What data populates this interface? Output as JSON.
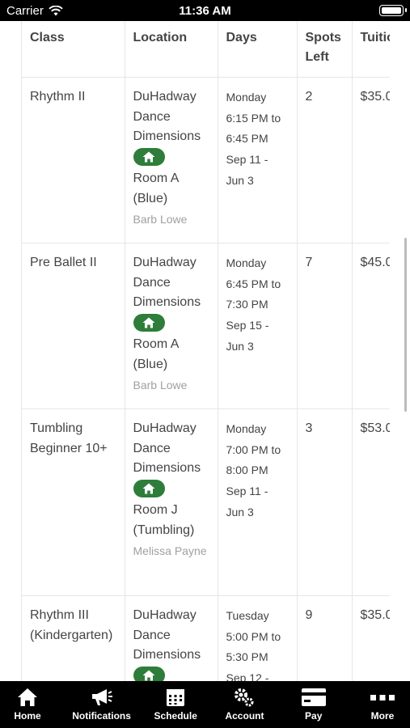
{
  "status_bar": {
    "carrier": "Carrier",
    "time": "11:36 AM"
  },
  "table": {
    "headers": {
      "class": "Class",
      "location": "Location",
      "days": "Days",
      "spots": "Spots Left",
      "tuition": "Tuitio"
    },
    "rows": [
      {
        "class": "Rhythm II",
        "location": "DuHadway Dance Dimensions",
        "room": "Room A (Blue)",
        "instructor": "Barb Lowe",
        "days": "Monday",
        "time": "6:15 PM to 6:45 PM",
        "dates": "Sep 11 - Jun 3",
        "spots": "2",
        "tuition": "$35.0"
      },
      {
        "class": "Pre Ballet II",
        "location": "DuHadway Dance Dimensions",
        "room": "Room A (Blue)",
        "instructor": "Barb Lowe",
        "days": "Monday",
        "time": "6:45 PM to 7:30 PM",
        "dates": "Sep 15 - Jun 3",
        "spots": "7",
        "tuition": "$45.0"
      },
      {
        "class": "Tumbling Beginner 10+",
        "location": "DuHadway Dance Dimensions",
        "room": "Room J (Tumbling)",
        "instructor": "Melissa Payne",
        "days": "Monday",
        "time": "7:00 PM to 8:00 PM",
        "dates": "Sep 11 - Jun 3",
        "spots": "3",
        "tuition": "$53.0"
      },
      {
        "class": "Rhythm III (Kindergarten)",
        "location": "DuHadway Dance Dimensions",
        "room": "",
        "instructor": "",
        "days": "Tuesday",
        "time": "5:00 PM to 5:30 PM",
        "dates": "Sep 12 -",
        "spots": "9",
        "tuition": "$35.0"
      }
    ]
  },
  "tab_bar": {
    "items": [
      {
        "label": "Home",
        "icon": "house-icon"
      },
      {
        "label": "Notifications",
        "icon": "megaphone-icon"
      },
      {
        "label": "Schedule",
        "icon": "calendar-icon"
      },
      {
        "label": "Account",
        "icon": "gears-icon"
      },
      {
        "label": "Pay",
        "icon": "credit-card-icon"
      },
      {
        "label": "More",
        "icon": "ellipsis-icon"
      }
    ]
  },
  "colors": {
    "badge_green": "#2f7d3a",
    "tab_bar": "#000000",
    "status_bar": "#000000"
  }
}
